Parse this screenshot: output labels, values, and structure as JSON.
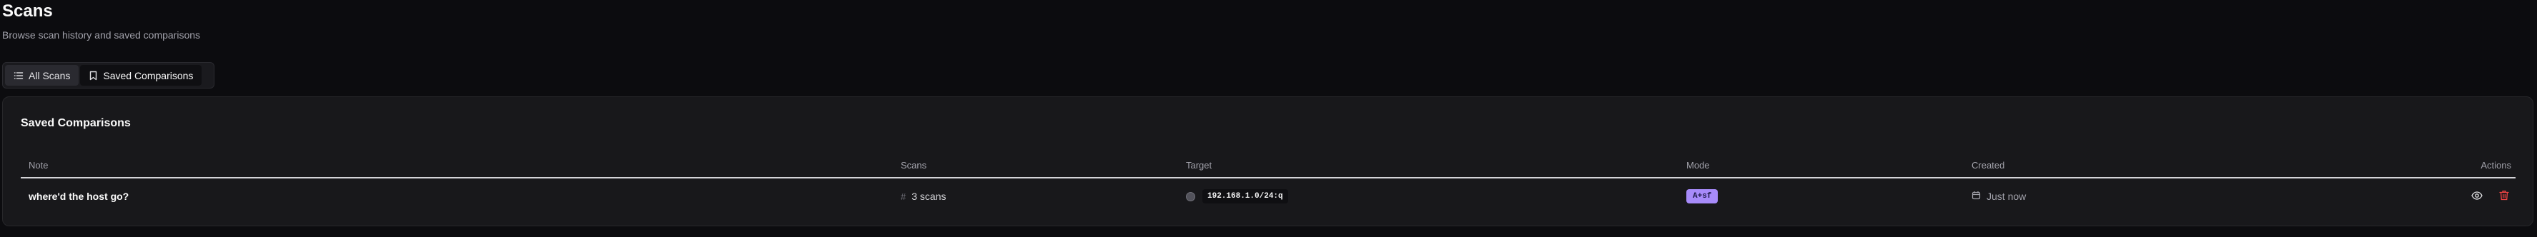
{
  "page": {
    "title": "Scans",
    "subtitle": "Browse scan history and saved comparisons"
  },
  "tabs": [
    {
      "label": "All Scans",
      "icon": "list-icon",
      "active": true
    },
    {
      "label": "Saved Comparisons",
      "icon": "bookmark-icon",
      "active": false
    }
  ],
  "card": {
    "title": "Saved Comparisons",
    "columns": [
      "Note",
      "Scans",
      "Target",
      "Mode",
      "Created",
      "Actions"
    ],
    "rows": [
      {
        "note": "where'd the host go?",
        "scans": "3 scans",
        "target": "192.168.1.0/24:q",
        "mode": "A+sf",
        "created": "Just now"
      }
    ]
  },
  "colors": {
    "background": "#0c0c0f",
    "card": "#18181b",
    "mode_badge": "#a78bfa",
    "delete": "#ef4444"
  }
}
